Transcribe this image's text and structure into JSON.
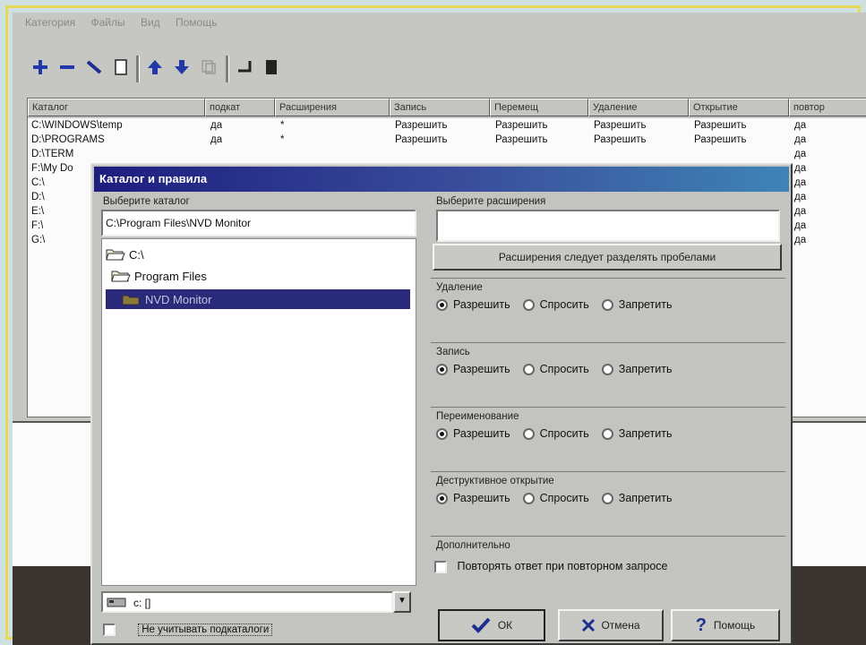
{
  "menu": [
    "Категория",
    "Файлы",
    "Вид",
    "Помощь"
  ],
  "toolbar": {
    "icons": [
      "plus-icon",
      "minus-icon",
      "edit-icon",
      "page-icon",
      "up-arrow-icon",
      "down-arrow-icon",
      "copy-icon",
      "split-icon",
      "black-square-icon"
    ]
  },
  "table": {
    "headers": [
      "Каталог",
      "подкат",
      "Расширения",
      "Запись",
      "Перемещ",
      "Удаление",
      "Открытие",
      "повтор"
    ],
    "rows": [
      {
        "path": "C:\\WINDOWS\\temp",
        "sub": "да",
        "ext": "*",
        "write": "Разрешить",
        "move": "Разрешить",
        "del": "Разрешить",
        "open": "Разрешить",
        "rep": "да"
      },
      {
        "path": "D:\\PROGRAMS",
        "sub": "да",
        "ext": "*",
        "write": "Разрешить",
        "move": "Разрешить",
        "del": "Разрешить",
        "open": "Разрешить",
        "rep": "да"
      },
      {
        "path": "D:\\TERM",
        "sub": "",
        "ext": "",
        "write": "",
        "move": "",
        "del": "",
        "open": "",
        "rep": "да"
      },
      {
        "path": "F:\\My Do",
        "sub": "",
        "ext": "",
        "write": "",
        "move": "",
        "del": "",
        "open": "",
        "rep": "да"
      },
      {
        "path": "C:\\",
        "sub": "",
        "ext": "",
        "write": "",
        "move": "",
        "del": "",
        "open": "",
        "rep": "да"
      },
      {
        "path": "D:\\",
        "sub": "",
        "ext": "",
        "write": "",
        "move": "",
        "del": "",
        "open": "",
        "rep": "да"
      },
      {
        "path": "E:\\",
        "sub": "",
        "ext": "",
        "write": "",
        "move": "",
        "del": "",
        "open": "",
        "rep": "да"
      },
      {
        "path": "F:\\",
        "sub": "",
        "ext": "",
        "write": "",
        "move": "",
        "del": "",
        "open": "",
        "rep": "да"
      },
      {
        "path": "G:\\",
        "sub": "",
        "ext": "",
        "write": "",
        "move": "",
        "del": "",
        "open": "",
        "rep": "да"
      }
    ]
  },
  "dialog": {
    "title": "Каталог и правила",
    "choose_dir_label": "Выберите каталог",
    "path_value": "C:\\Program Files\\NVD Monitor",
    "tree": [
      "C:\\",
      "Program Files",
      "NVD Monitor"
    ],
    "drive_value": "c: []",
    "subdirs_checkbox": "Не учитывать подкаталоги",
    "choose_ext_label": "Выберите расширения",
    "ext_value": "",
    "ext_hint_button": "Расширения следует разделять пробелами",
    "groups": [
      {
        "title": "Удаление",
        "options": [
          "Разрешить",
          "Спросить",
          "Запретить"
        ],
        "selected": 0
      },
      {
        "title": "Запись",
        "options": [
          "Разрешить",
          "Спросить",
          "Запретить"
        ],
        "selected": 0
      },
      {
        "title": "Переименование",
        "options": [
          "Разрешить",
          "Спросить",
          "Запретить"
        ],
        "selected": 0
      },
      {
        "title": "Деструктивное открытие",
        "options": [
          "Разрешить",
          "Спросить",
          "Запретить"
        ],
        "selected": 0
      }
    ],
    "extra_title": "Дополнительно",
    "repeat_checkbox": "Повторять ответ при повторном запросе",
    "ok_label": "ОК",
    "cancel_label": "Отмена",
    "help_label": "Помощь"
  }
}
